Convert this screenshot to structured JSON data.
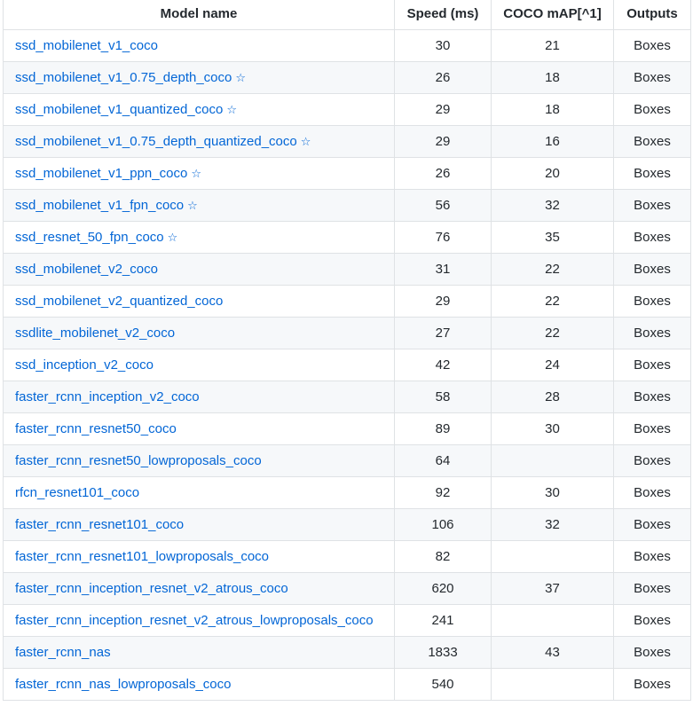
{
  "table": {
    "headers": {
      "model_name": "Model name",
      "speed": "Speed (ms)",
      "coco_map": "COCO mAP[^1]",
      "outputs": "Outputs"
    },
    "rows": [
      {
        "name": "ssd_mobilenet_v1_coco",
        "star": "",
        "speed": "30",
        "map": "21",
        "outputs": "Boxes"
      },
      {
        "name": "ssd_mobilenet_v1_0.75_depth_coco",
        "star": "☆",
        "speed": "26",
        "map": "18",
        "outputs": "Boxes"
      },
      {
        "name": "ssd_mobilenet_v1_quantized_coco",
        "star": "☆",
        "speed": "29",
        "map": "18",
        "outputs": "Boxes"
      },
      {
        "name": "ssd_mobilenet_v1_0.75_depth_quantized_coco",
        "star": "☆",
        "speed": "29",
        "map": "16",
        "outputs": "Boxes"
      },
      {
        "name": "ssd_mobilenet_v1_ppn_coco",
        "star": "☆",
        "speed": "26",
        "map": "20",
        "outputs": "Boxes"
      },
      {
        "name": "ssd_mobilenet_v1_fpn_coco",
        "star": "☆",
        "speed": "56",
        "map": "32",
        "outputs": "Boxes"
      },
      {
        "name": "ssd_resnet_50_fpn_coco",
        "star": "☆",
        "speed": "76",
        "map": "35",
        "outputs": "Boxes"
      },
      {
        "name": "ssd_mobilenet_v2_coco",
        "star": "",
        "speed": "31",
        "map": "22",
        "outputs": "Boxes"
      },
      {
        "name": "ssd_mobilenet_v2_quantized_coco",
        "star": "",
        "speed": "29",
        "map": "22",
        "outputs": "Boxes"
      },
      {
        "name": "ssdlite_mobilenet_v2_coco",
        "star": "",
        "speed": "27",
        "map": "22",
        "outputs": "Boxes"
      },
      {
        "name": "ssd_inception_v2_coco",
        "star": "",
        "speed": "42",
        "map": "24",
        "outputs": "Boxes"
      },
      {
        "name": "faster_rcnn_inception_v2_coco",
        "star": "",
        "speed": "58",
        "map": "28",
        "outputs": "Boxes"
      },
      {
        "name": "faster_rcnn_resnet50_coco",
        "star": "",
        "speed": "89",
        "map": "30",
        "outputs": "Boxes"
      },
      {
        "name": "faster_rcnn_resnet50_lowproposals_coco",
        "star": "",
        "speed": "64",
        "map": "",
        "outputs": "Boxes"
      },
      {
        "name": "rfcn_resnet101_coco",
        "star": "",
        "speed": "92",
        "map": "30",
        "outputs": "Boxes"
      },
      {
        "name": "faster_rcnn_resnet101_coco",
        "star": "",
        "speed": "106",
        "map": "32",
        "outputs": "Boxes"
      },
      {
        "name": "faster_rcnn_resnet101_lowproposals_coco",
        "star": "",
        "speed": "82",
        "map": "",
        "outputs": "Boxes"
      },
      {
        "name": "faster_rcnn_inception_resnet_v2_atrous_coco",
        "star": "",
        "speed": "620",
        "map": "37",
        "outputs": "Boxes"
      },
      {
        "name": "faster_rcnn_inception_resnet_v2_atrous_lowproposals_coco",
        "star": "",
        "speed": "241",
        "map": "",
        "outputs": "Boxes"
      },
      {
        "name": "faster_rcnn_nas",
        "star": "",
        "speed": "1833",
        "map": "43",
        "outputs": "Boxes"
      },
      {
        "name": "faster_rcnn_nas_lowproposals_coco",
        "star": "",
        "speed": "540",
        "map": "",
        "outputs": "Boxes"
      }
    ]
  },
  "colors": {
    "link": "#0366d6",
    "border": "#dfe2e5",
    "stripe": "#f6f8fa",
    "text": "#24292e"
  },
  "icons": {
    "star": "star-outline-icon"
  }
}
